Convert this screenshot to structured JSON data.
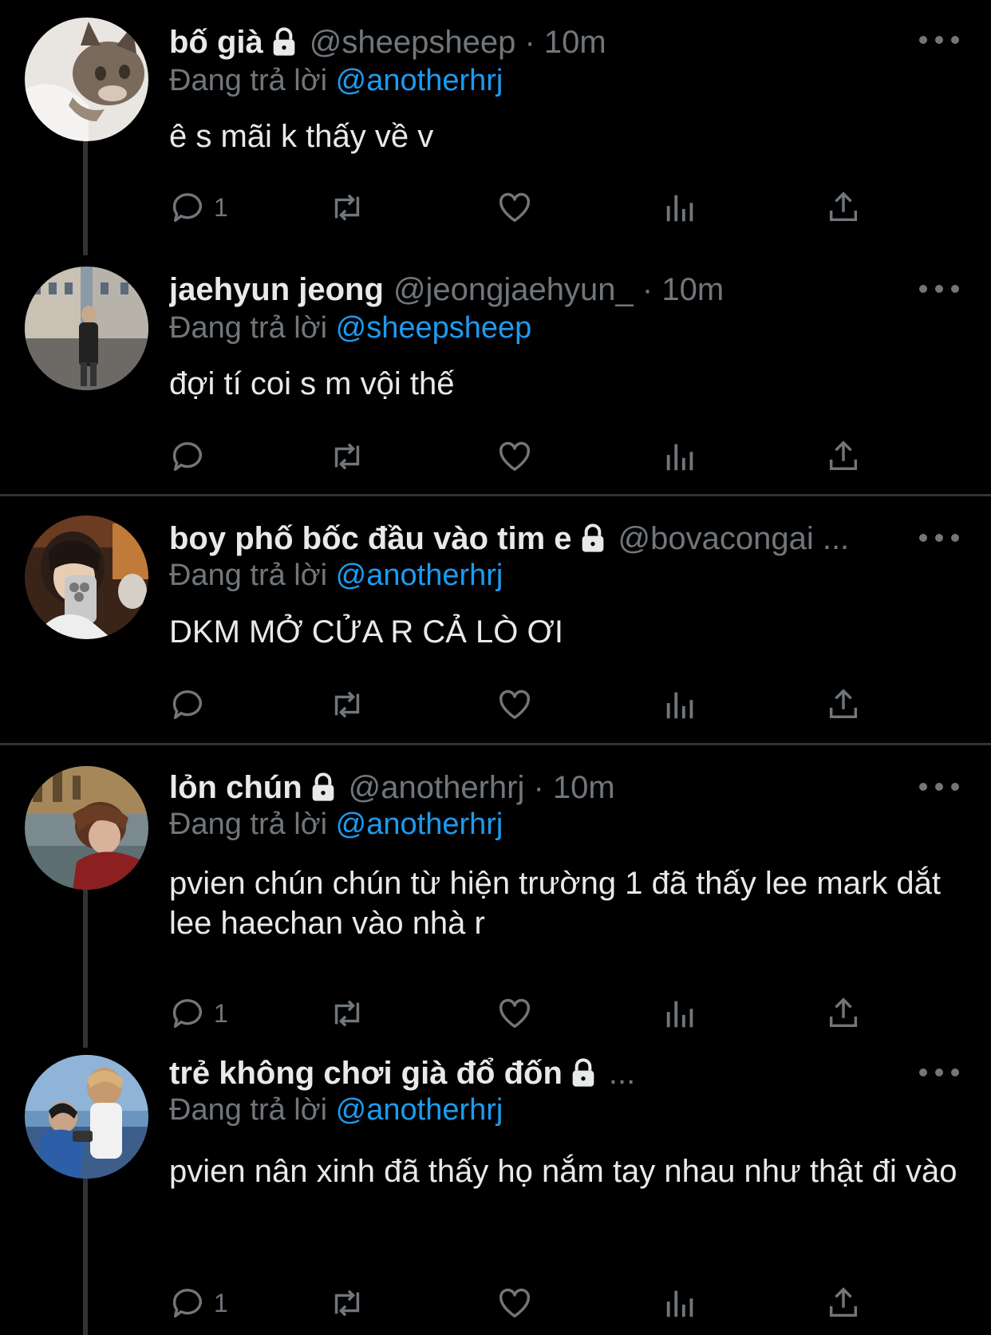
{
  "reply_prefix": "Đang trả lời",
  "tweets": [
    {
      "name": "bố già",
      "locked": true,
      "meta": "@sheepsheep · 10m",
      "reply_to": "@anotherhrj",
      "text": "ê s mãi k thấy về v",
      "reply_count": "1"
    },
    {
      "name": "jaehyun jeong",
      "locked": false,
      "meta": "@jeongjaehyun_ · 10m",
      "reply_to": "@sheepsheep",
      "text": "đợi tí coi s m vội thế",
      "reply_count": ""
    },
    {
      "name": "boy phố bốc đầu vào tim e",
      "locked": true,
      "meta": "@bovacongai ...",
      "reply_to": "@anotherhrj",
      "text": "DKM MỞ CỬA R CẢ LÒ ƠI",
      "reply_count": ""
    },
    {
      "name": "lỏn chún",
      "locked": true,
      "meta": "@anotherhrj · 10m",
      "reply_to": "@anotherhrj",
      "text": "pvien chún chún từ hiện trường 1 đã thấy lee mark dắt lee haechan vào nhà r",
      "reply_count": "1"
    },
    {
      "name": "trẻ không chơi già đổ đốn",
      "locked": true,
      "meta": "...",
      "reply_to": "@anotherhrj",
      "text": "pvien nân xinh đã thấy họ nắm tay nhau như thật đi vào",
      "reply_count": "1"
    }
  ],
  "icons": {
    "reply": "reply-icon",
    "retweet": "retweet-icon",
    "like": "heart-icon",
    "views": "views-icon",
    "share": "share-icon",
    "more": "more-icon",
    "lock": "lock-icon"
  },
  "colors": {
    "background": "#000000",
    "text": "#e7e9ea",
    "muted": "#71767b",
    "link": "#1d9bf0",
    "divider": "#2f3336"
  }
}
